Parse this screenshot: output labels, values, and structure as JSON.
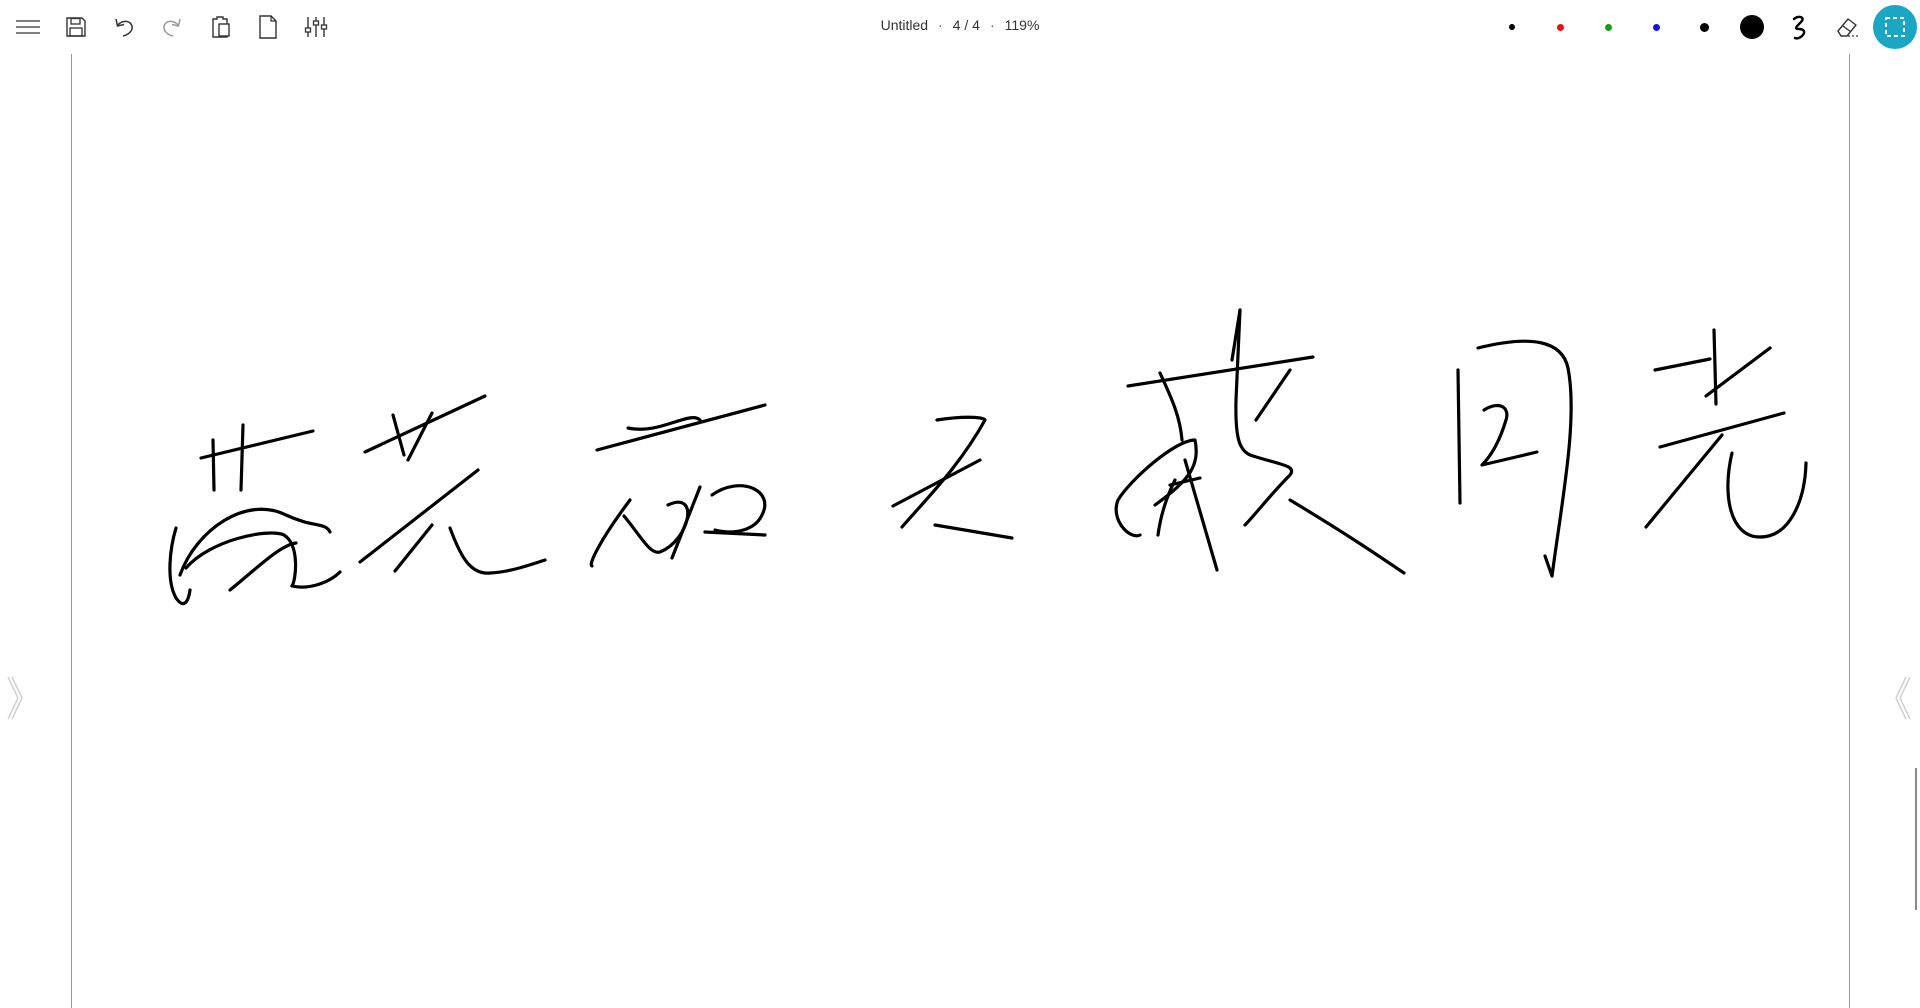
{
  "toolbar": {
    "left_tools": [
      {
        "name": "menu-icon"
      },
      {
        "name": "save-icon"
      },
      {
        "name": "undo-icon"
      },
      {
        "name": "redo-icon"
      },
      {
        "name": "clipboard-icon"
      },
      {
        "name": "page-icon"
      },
      {
        "name": "settings-sliders-icon"
      }
    ],
    "right_tools": {
      "pens": [
        {
          "name": "pen-black-small",
          "color": "#000000"
        },
        {
          "name": "pen-red",
          "color": "#e81010"
        },
        {
          "name": "pen-green",
          "color": "#12a012"
        },
        {
          "name": "pen-blue",
          "color": "#1414e0"
        },
        {
          "name": "pen-black-medium",
          "color": "#000000"
        },
        {
          "name": "pen-black-large",
          "color": "#000000"
        }
      ],
      "stroke_style": "squiggle-icon",
      "eraser": "eraser-icon",
      "select": "selection-icon",
      "select_color": "#1ba6c3"
    }
  },
  "document": {
    "title": "Untitled",
    "page_indicator": "4 / 4",
    "zoom": "119%"
  },
  "canvas": {
    "margin_color": "#e07a86",
    "ink_color": "#000000"
  }
}
